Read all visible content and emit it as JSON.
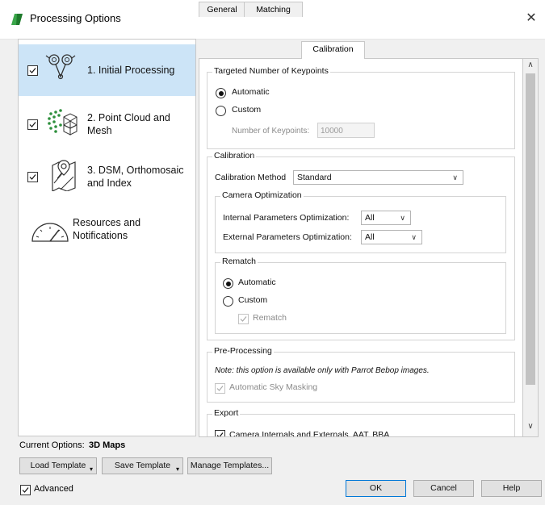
{
  "window": {
    "title": "Processing Options",
    "accent_color": "#2d8f3c",
    "close_glyph": "✕"
  },
  "sidebar": {
    "items": [
      {
        "label": "1. Initial Processing",
        "checked": true,
        "selected": true,
        "icon": "initial-processing-icon"
      },
      {
        "label_line1": "2. Point Cloud and",
        "label_line2": "Mesh",
        "checked": true,
        "selected": false,
        "icon": "point-cloud-icon"
      },
      {
        "label_line1": "3. DSM, Orthomosaic",
        "label_line2": "and Index",
        "checked": true,
        "selected": false,
        "icon": "dsm-map-icon"
      },
      {
        "label_line1": "Resources and",
        "label_line2": "Notifications",
        "checked": false,
        "selected": false,
        "icon": "gauge-icon"
      }
    ],
    "selected_color": "#cce4f7"
  },
  "tabs": [
    {
      "label": "General",
      "active": false
    },
    {
      "label": "Matching",
      "active": false
    },
    {
      "label": "Calibration",
      "active": true
    }
  ],
  "keypoints": {
    "title": "Targeted Number of Keypoints",
    "automatic_label": "Automatic",
    "custom_label": "Custom",
    "selected": "Automatic",
    "number_label": "Number of Keypoints:",
    "number_value": "10000"
  },
  "calibration": {
    "title": "Calibration",
    "method_label": "Calibration Method",
    "method_value": "Standard",
    "camera_opt": {
      "title": "Camera Optimization",
      "internal_label": "Internal Parameters Optimization:",
      "internal_value": "All",
      "external_label": "External Parameters Optimization:",
      "external_value": "All"
    },
    "rematch": {
      "title": "Rematch",
      "automatic_label": "Automatic",
      "custom_label": "Custom",
      "selected": "Automatic",
      "rematch_label": "Rematch",
      "rematch_checked": true
    }
  },
  "preprocessing": {
    "title": "Pre-Processing",
    "note": "Note: this option is available only with Parrot Bebop images.",
    "sky_masking_label": "Automatic Sky Masking",
    "sky_masking_checked": true
  },
  "export": {
    "title": "Export",
    "item_label": "Camera Internals and Externals, AAT, BBA",
    "item_checked": true
  },
  "footer": {
    "current_options_label": "Current Options:",
    "current_options_value": "3D Maps",
    "load_template": "Load Template",
    "save_template": "Save Template",
    "manage_templates": "Manage Templates...",
    "advanced_label": "Advanced",
    "advanced_checked": true,
    "ok": "OK",
    "cancel": "Cancel",
    "help": "Help"
  }
}
